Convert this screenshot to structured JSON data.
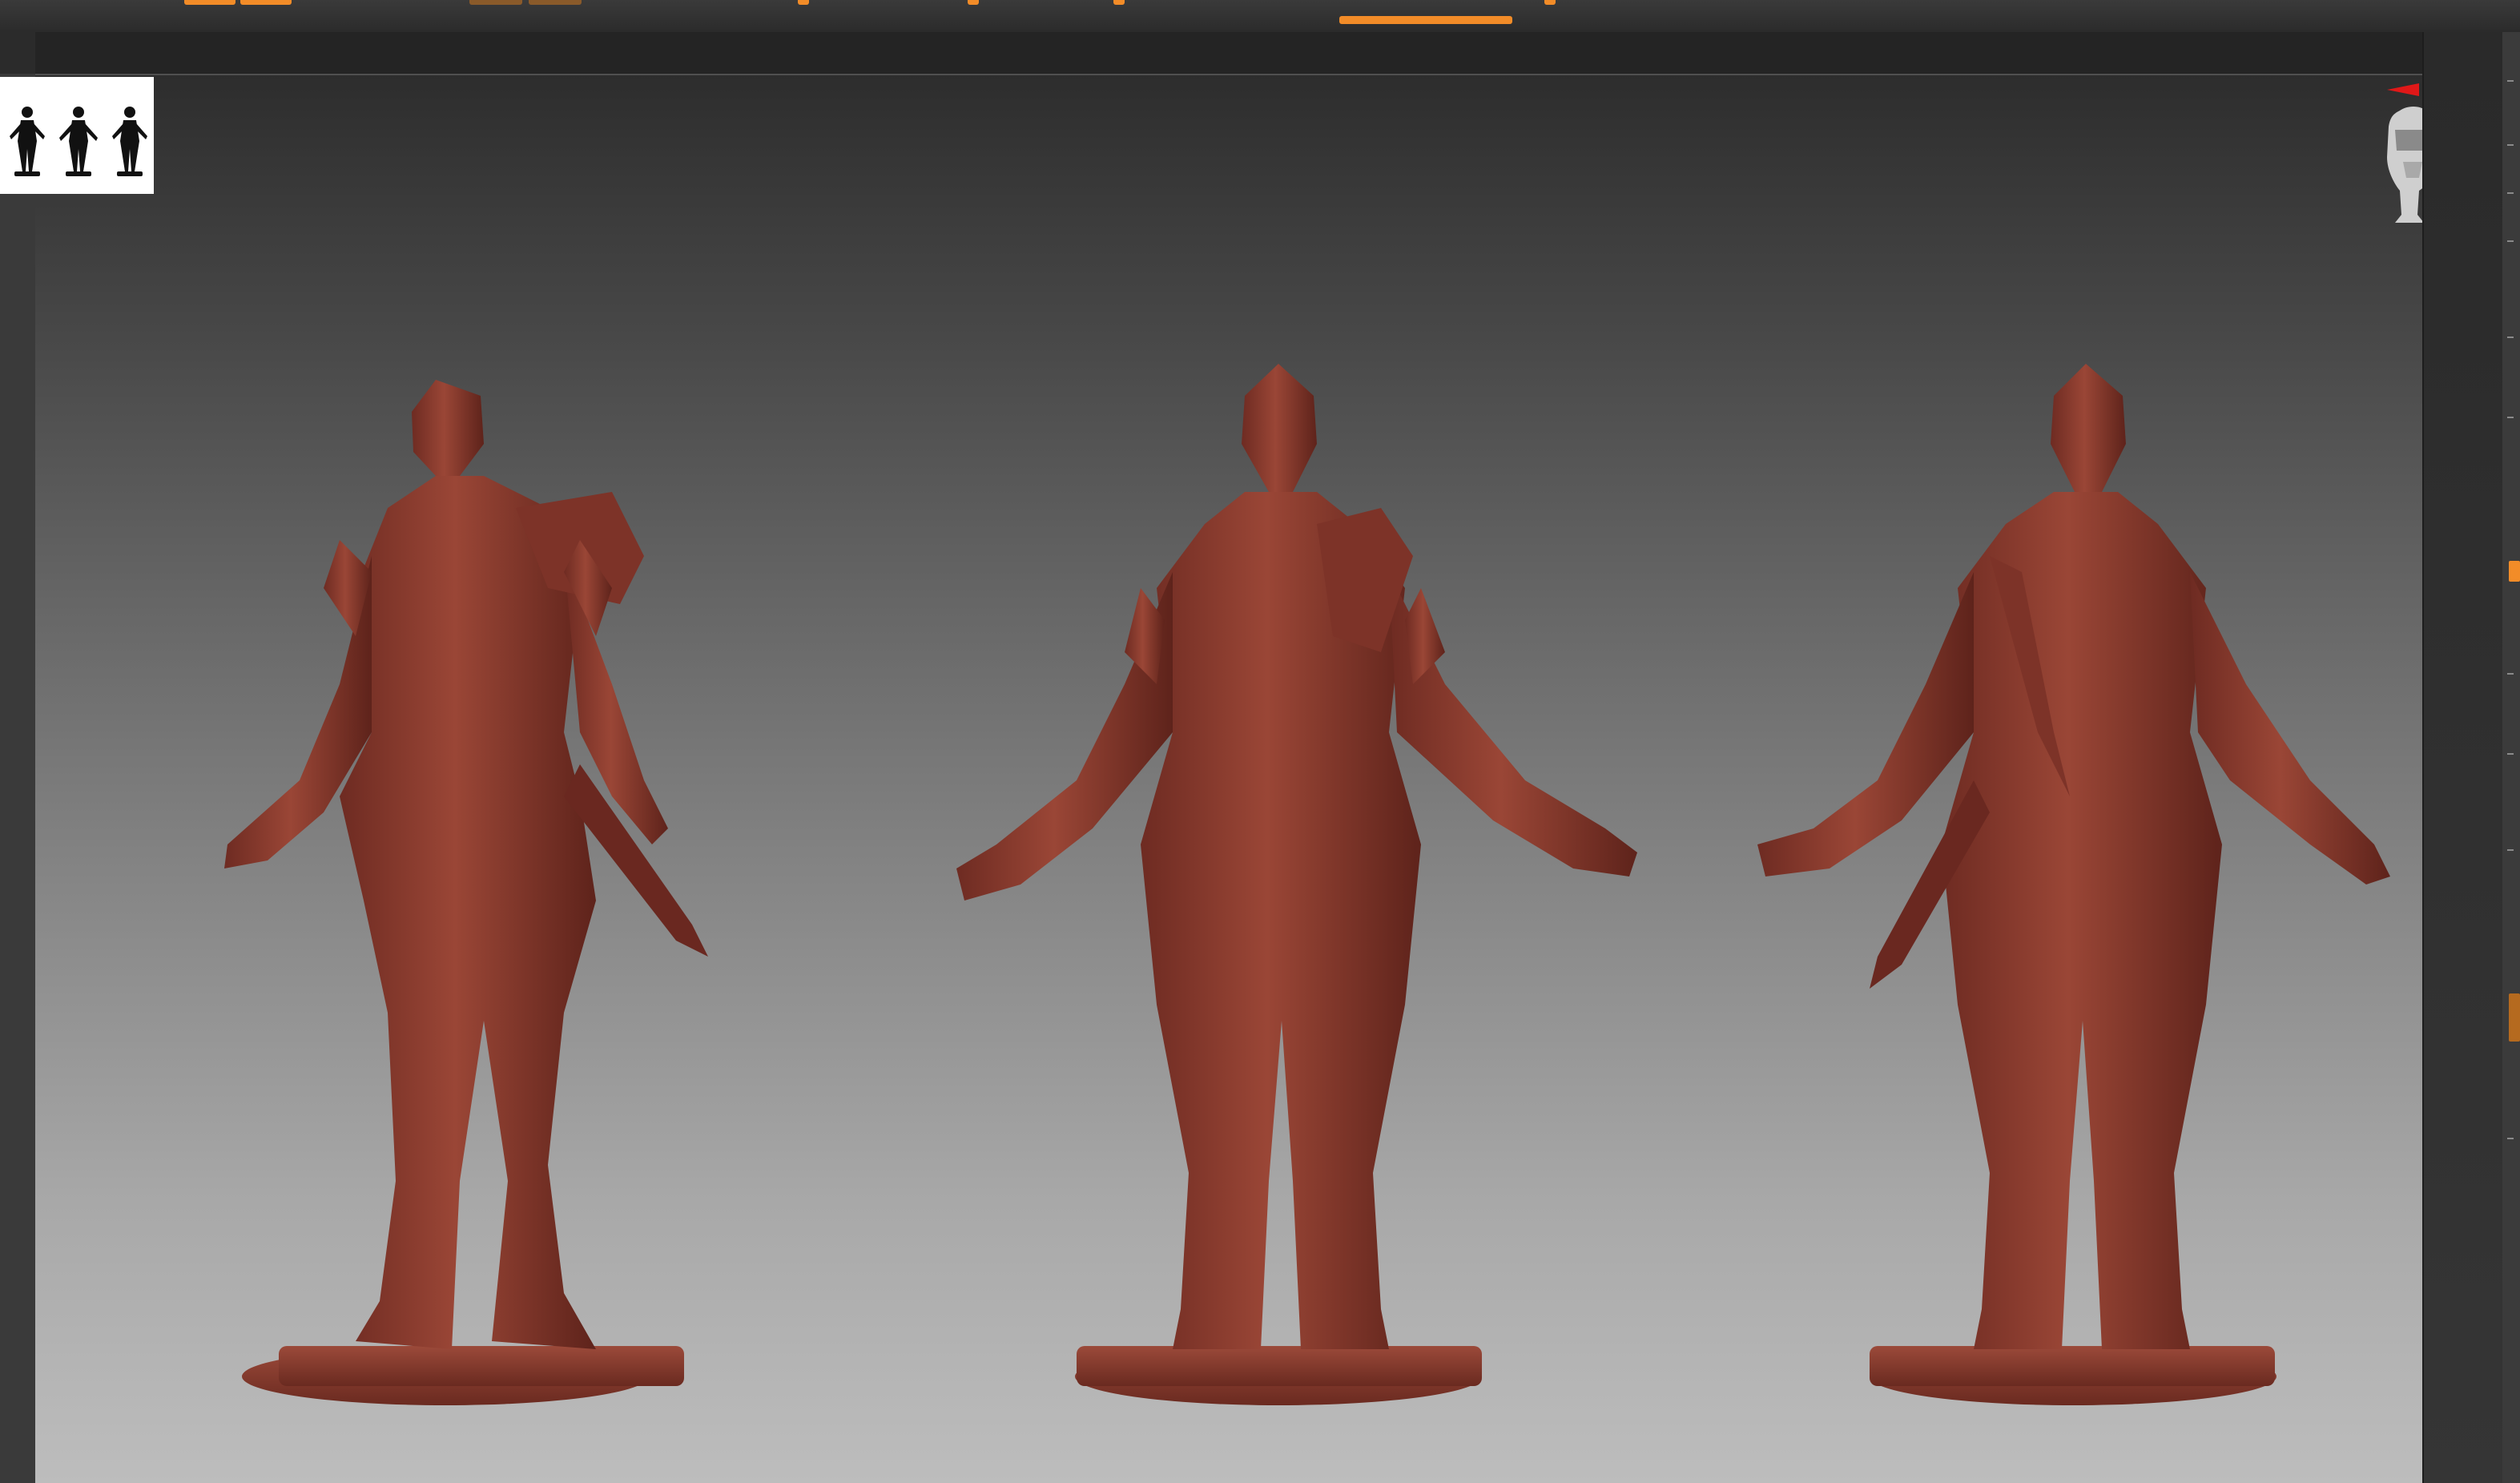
{
  "colors": {
    "accent": "#f28c28",
    "clay": "#8b3a2e",
    "viewport_top": "#2d2d2d",
    "viewport_bottom": "#bdbdbd"
  },
  "viewport": {
    "figures": [
      "front-three-quarter-view",
      "front-view",
      "back-view"
    ]
  },
  "icons": {
    "thumbnail": "silhouette-thumbnail-icon",
    "navigator_head": "head-navigator-icon",
    "axis_gizmo": "axis-gizmo-icon"
  }
}
